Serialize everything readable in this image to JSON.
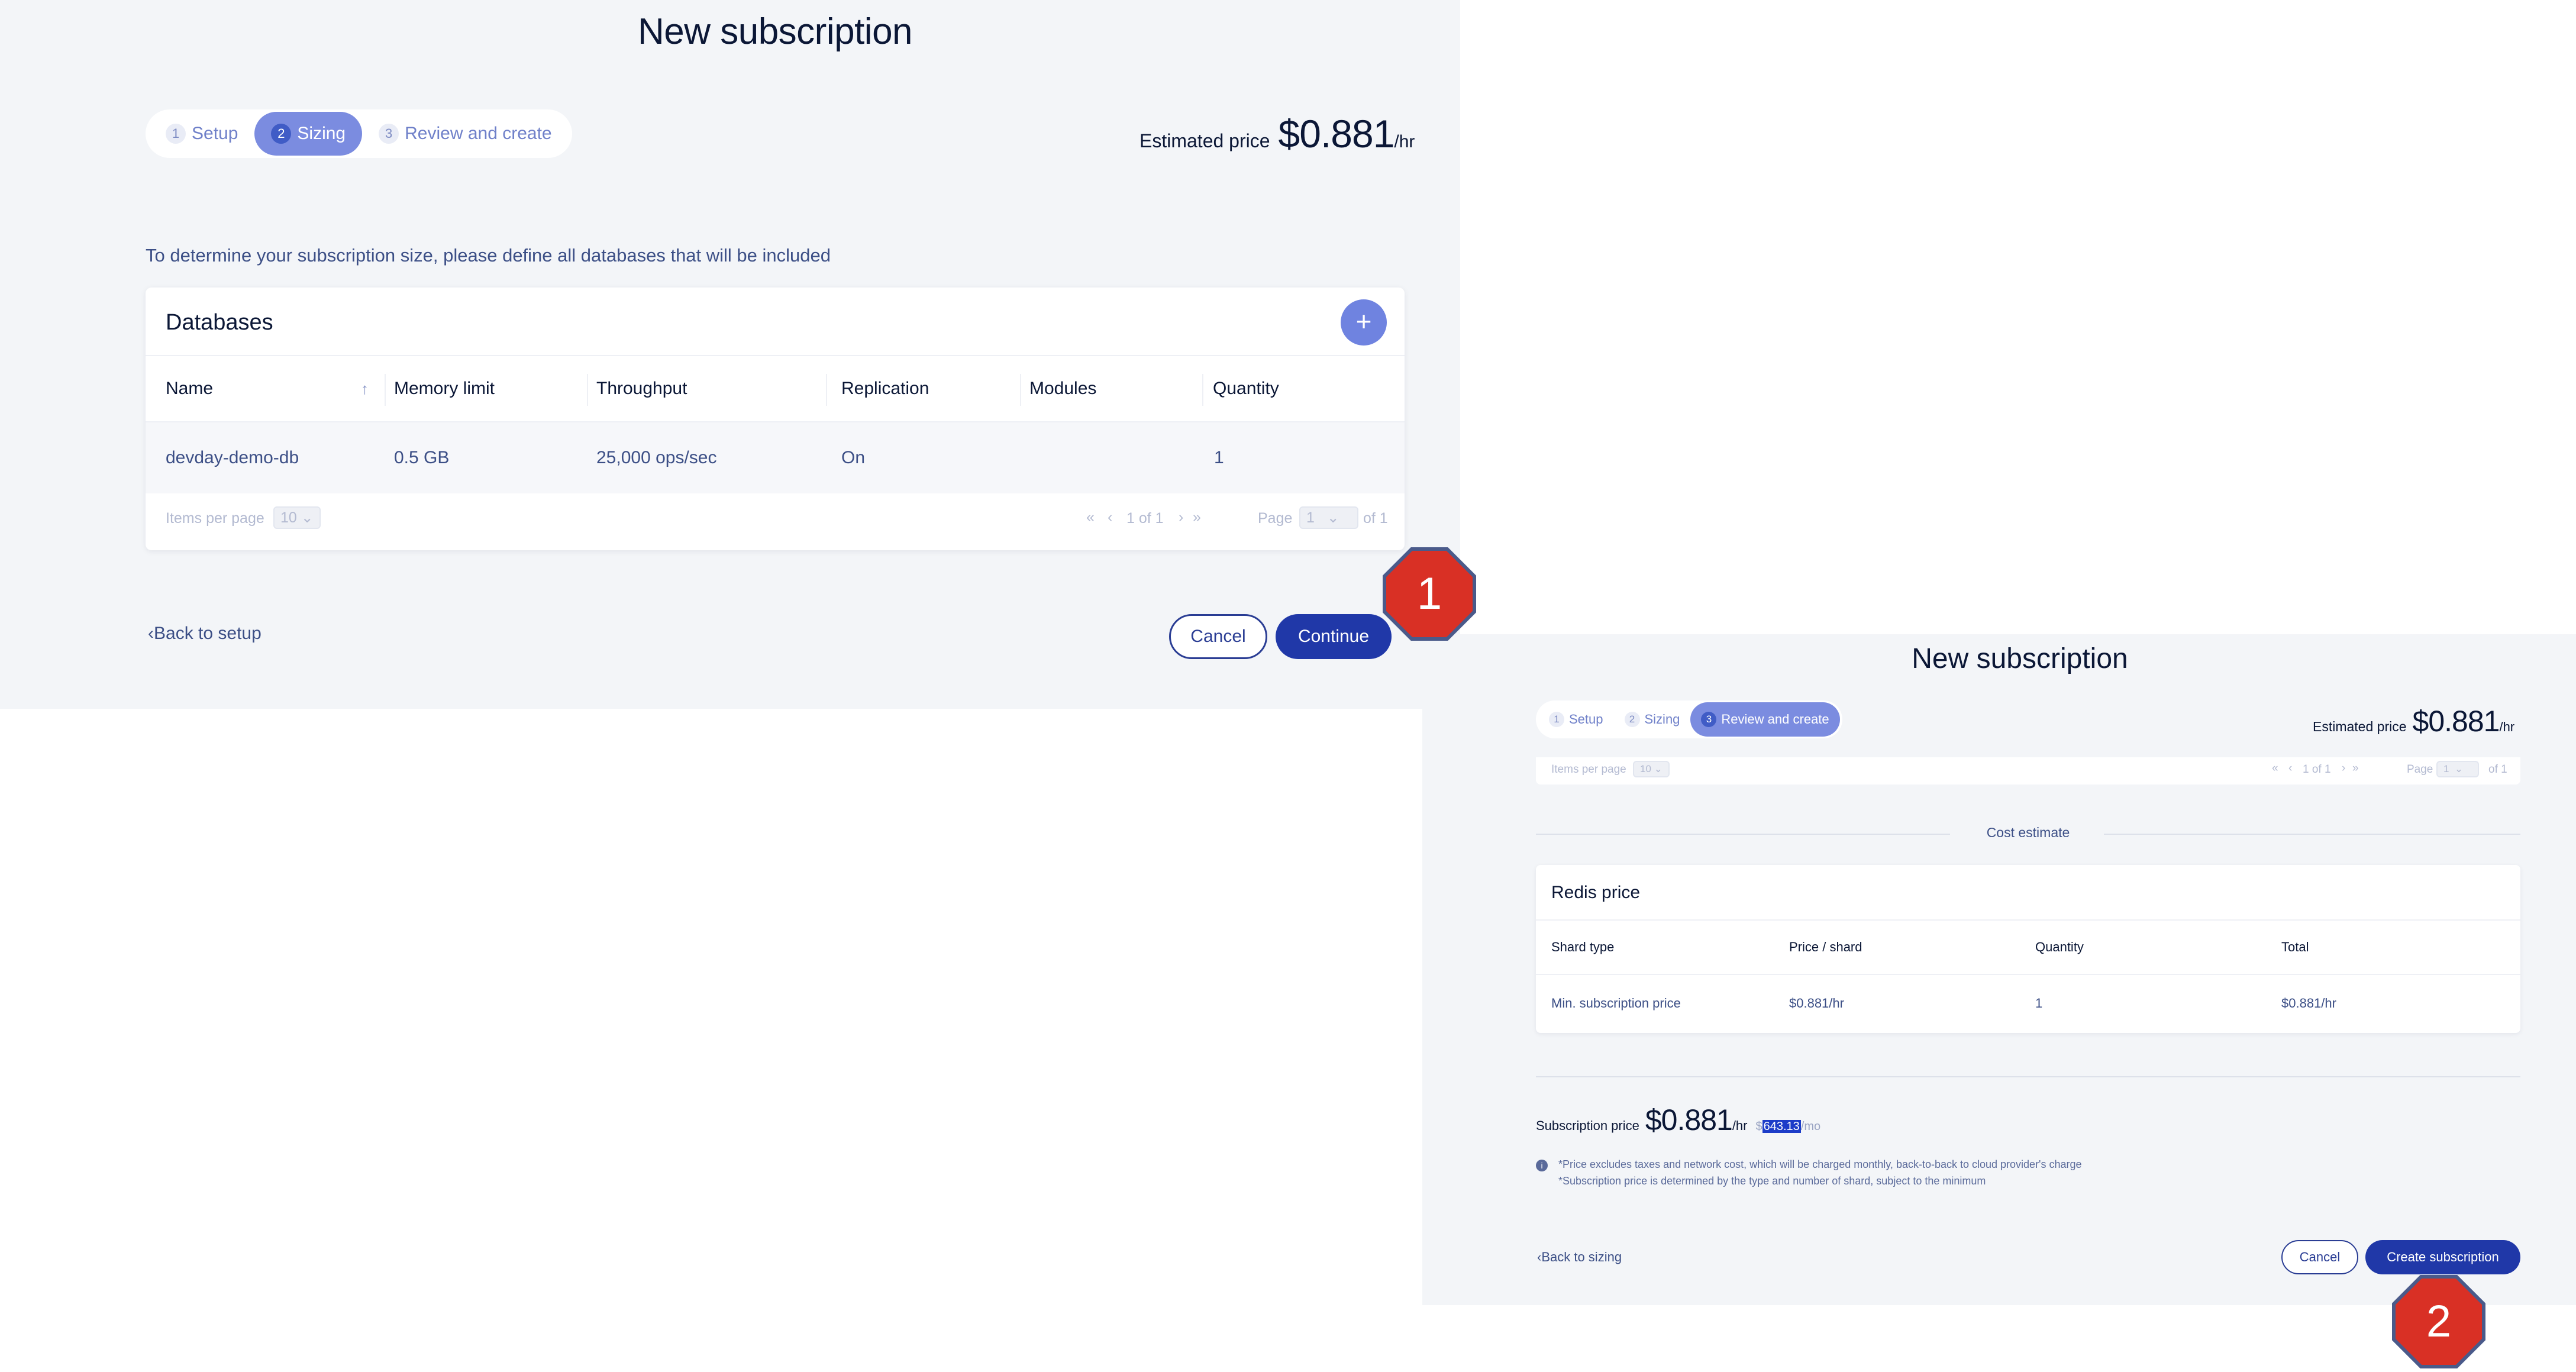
{
  "panel1": {
    "title": "New subscription",
    "steps": [
      {
        "num": "1",
        "label": "Setup"
      },
      {
        "num": "2",
        "label": "Sizing"
      },
      {
        "num": "3",
        "label": "Review and create"
      }
    ],
    "active_step": 2,
    "estimated_price": {
      "label": "Estimated price",
      "value": "$0.881",
      "unit": "/hr"
    },
    "intro": "To determine your subscription size, please define all databases that will be included",
    "databases": {
      "title": "Databases",
      "add_label": "+",
      "columns": [
        "Name",
        "Memory limit",
        "Throughput",
        "Replication",
        "Modules",
        "Quantity"
      ],
      "sort_icon": "↑",
      "rows": [
        {
          "name": "devday-demo-db",
          "memory": "0.5 GB",
          "throughput": "25,000 ops/sec",
          "replication": "On",
          "modules": "",
          "quantity": "1"
        }
      ],
      "pager": {
        "items_per_page_label": "Items per page",
        "items_per_page": "10",
        "range": "1 of 1",
        "page_label": "Page",
        "page": "1",
        "of_pages": "of 1"
      }
    },
    "back_link": "Back to setup",
    "cancel": "Cancel",
    "continue": "Continue"
  },
  "panel2": {
    "title": "New subscription",
    "steps": [
      {
        "num": "1",
        "label": "Setup"
      },
      {
        "num": "2",
        "label": "Sizing"
      },
      {
        "num": "3",
        "label": "Review and create"
      }
    ],
    "active_step": 3,
    "estimated_price": {
      "label": "Estimated price",
      "value": "$0.881",
      "unit": "/hr"
    },
    "pager": {
      "items_per_page_label": "Items per page",
      "items_per_page": "10",
      "range": "1 of 1",
      "page_label": "Page",
      "page": "1",
      "of_pages": "of 1"
    },
    "cost_estimate": "Cost estimate",
    "redis_price": {
      "title": "Redis price",
      "columns": [
        "Shard type",
        "Price / shard",
        "Quantity",
        "Total"
      ],
      "rows": [
        {
          "shard_type": "Min. subscription price",
          "price": "$0.881/hr",
          "quantity": "1",
          "total": "$0.881/hr"
        }
      ]
    },
    "subscription_price": {
      "label": "Subscription price",
      "value": "$0.881",
      "unit": "/hr",
      "mo_prefix": "$",
      "mo_value": "643.13",
      "mo_unit": "/mo"
    },
    "notes": [
      "*Price excludes taxes and network cost, which will be charged monthly, back-to-back to cloud provider's charge",
      "*Subscription price is determined by the type and number of shard, subject to the minimum"
    ],
    "back_link": "Back to sizing",
    "cancel": "Cancel",
    "create": "Create subscription"
  },
  "badges": [
    "1",
    "2"
  ],
  "colors": {
    "accent": "#2038a8",
    "active_step": "#7b8ce0",
    "badge": "#d93025",
    "panel_bg": "#f3f5f8"
  }
}
